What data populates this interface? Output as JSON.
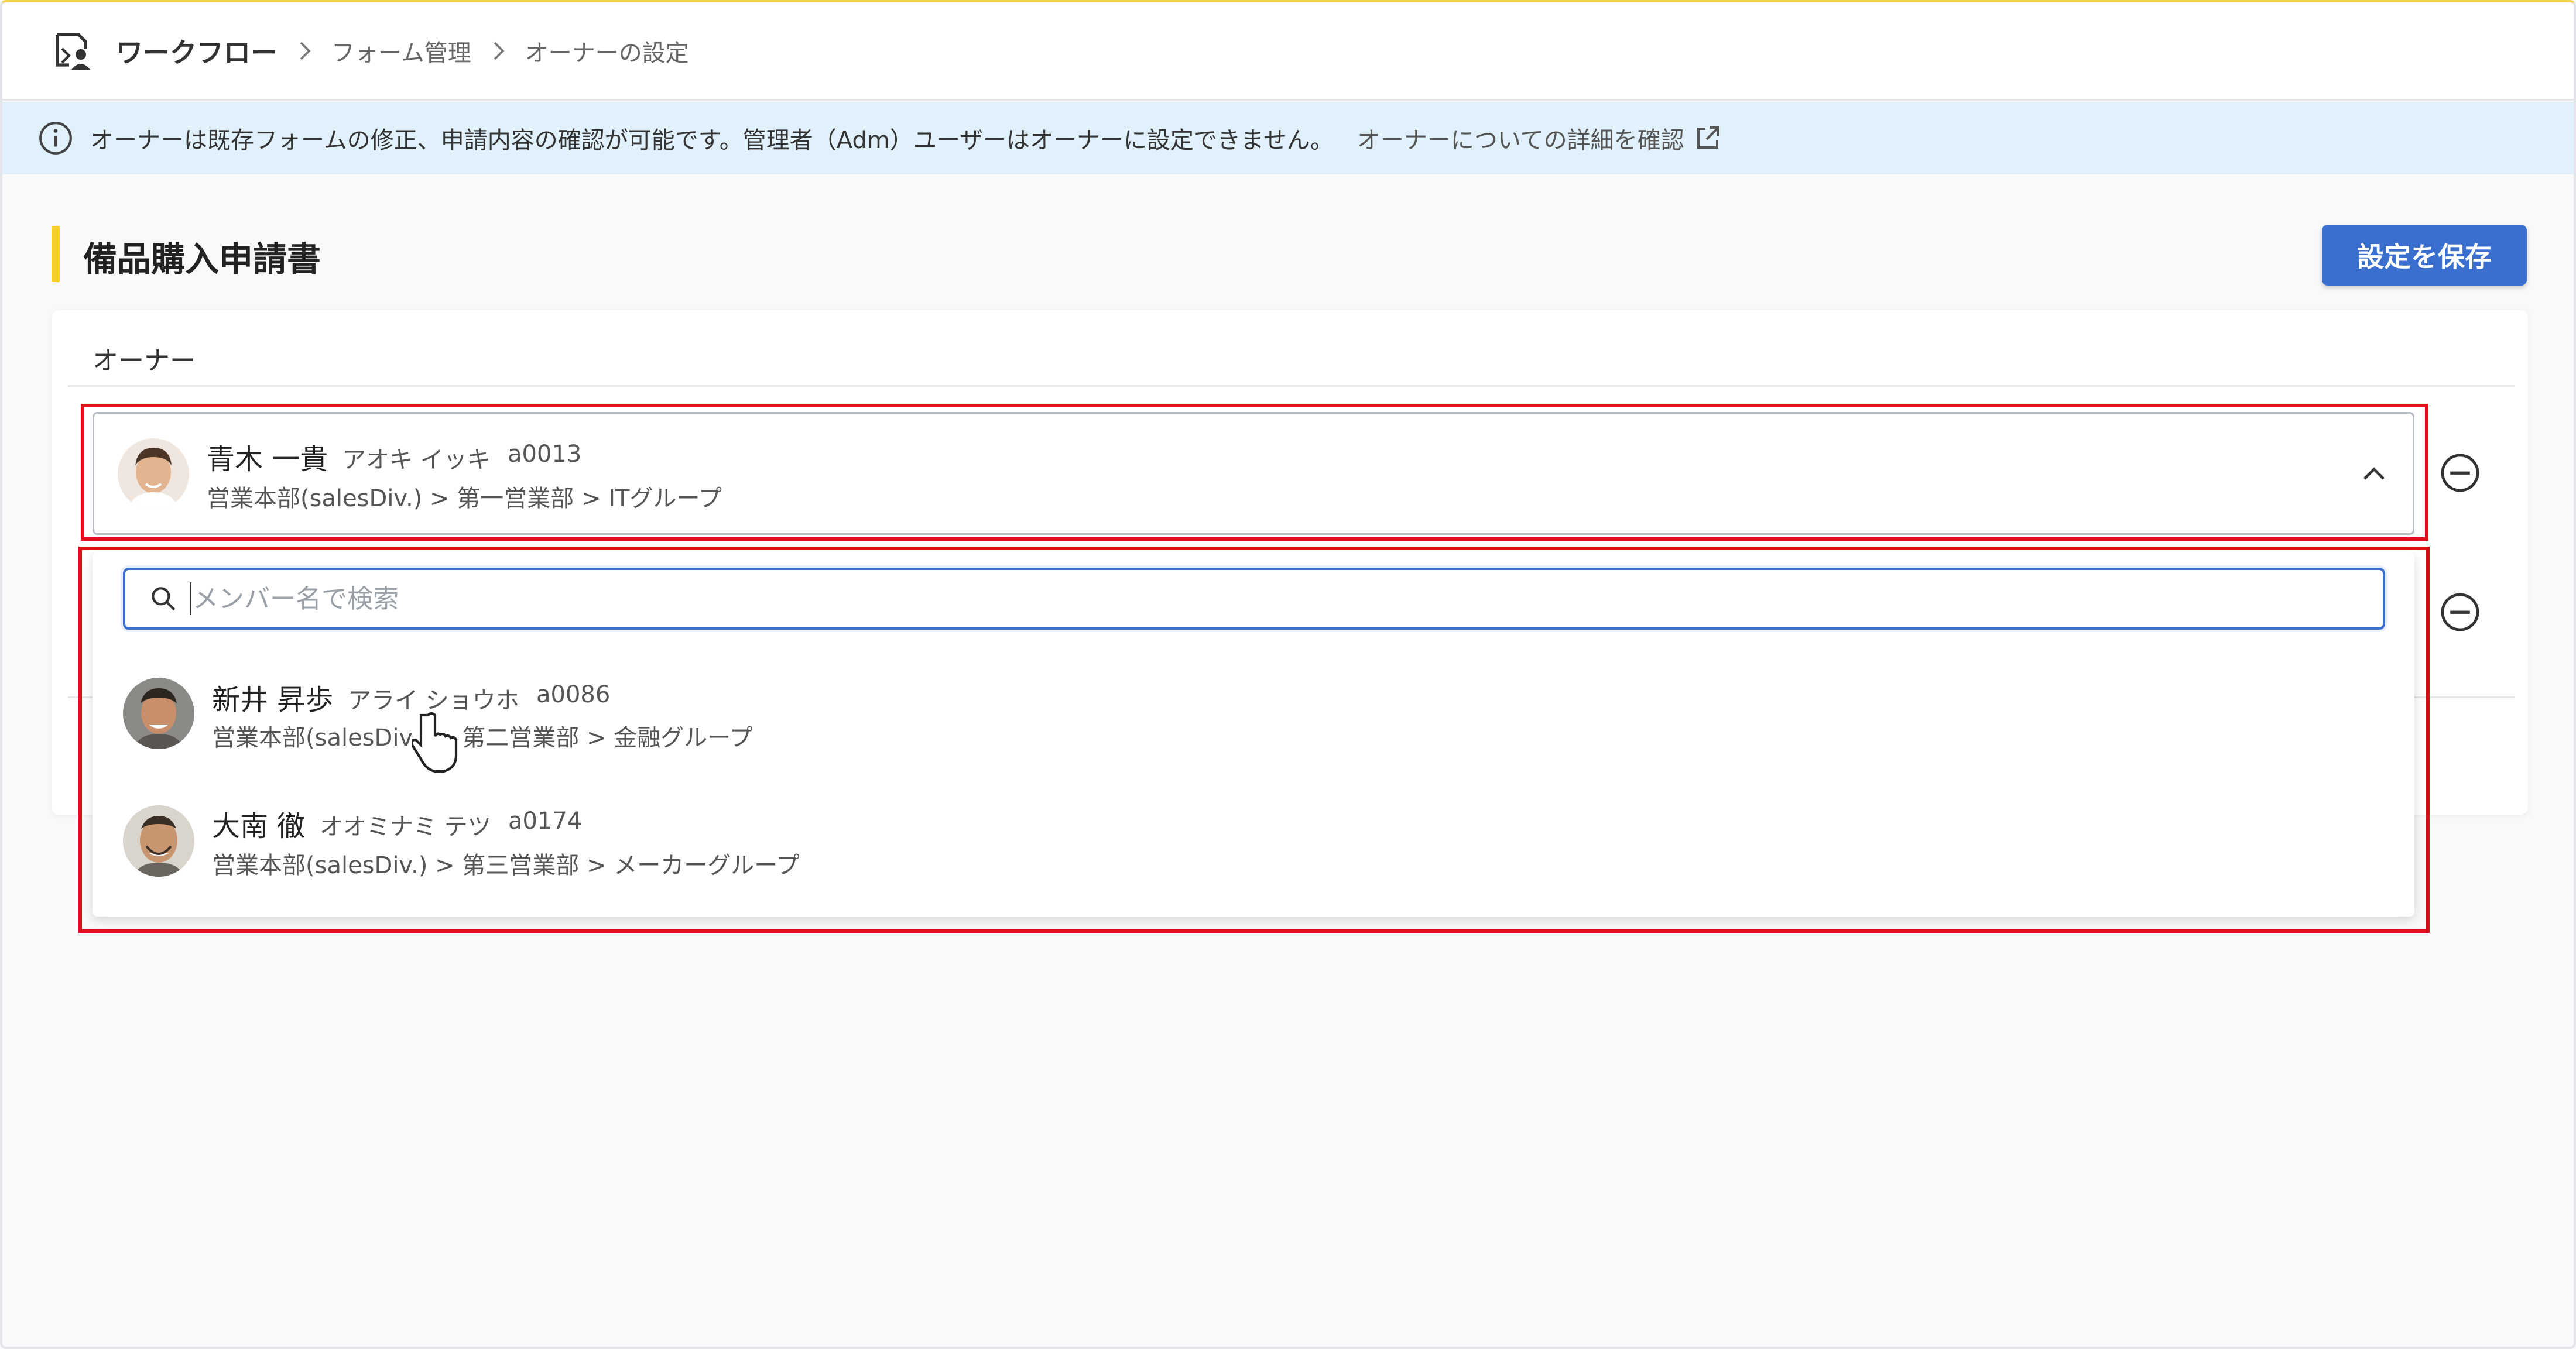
{
  "breadcrumb": {
    "root": "ワークフロー",
    "items": [
      "フォーム管理",
      "オーナーの設定"
    ]
  },
  "info": {
    "message": "オーナーは既存フォームの修正、申請内容の確認が可能です。管理者（Adm）ユーザーはオーナーに設定できません。",
    "link": "オーナーについての詳細を確認"
  },
  "page": {
    "title": "備品購入申請書",
    "save_label": "設定を保存"
  },
  "owner_section": {
    "label": "オーナー",
    "selected": {
      "name": "青木 一貴",
      "kana": "アオキ イッキ",
      "id": "a0013",
      "dept": "営業本部(salesDiv.) > 第一営業部 > ITグループ"
    }
  },
  "search": {
    "placeholder": "メンバー名で検索",
    "value": ""
  },
  "options": [
    {
      "name": "新井 昇歩",
      "kana": "アライ ショウホ",
      "id": "a0086",
      "dept": "営業本部(salesDiv.) > 第二営業部 > 金融グループ"
    },
    {
      "name": "大南 徹",
      "kana": "オオミナミ テツ",
      "id": "a0174",
      "dept": "営業本部(salesDiv.) > 第三営業部 > メーカーグループ"
    }
  ],
  "colors": {
    "accent": "#3a6fcf",
    "title_bar": "#f5cf2e",
    "info_bg": "#e1f1fc",
    "highlight": "#e0101a"
  }
}
